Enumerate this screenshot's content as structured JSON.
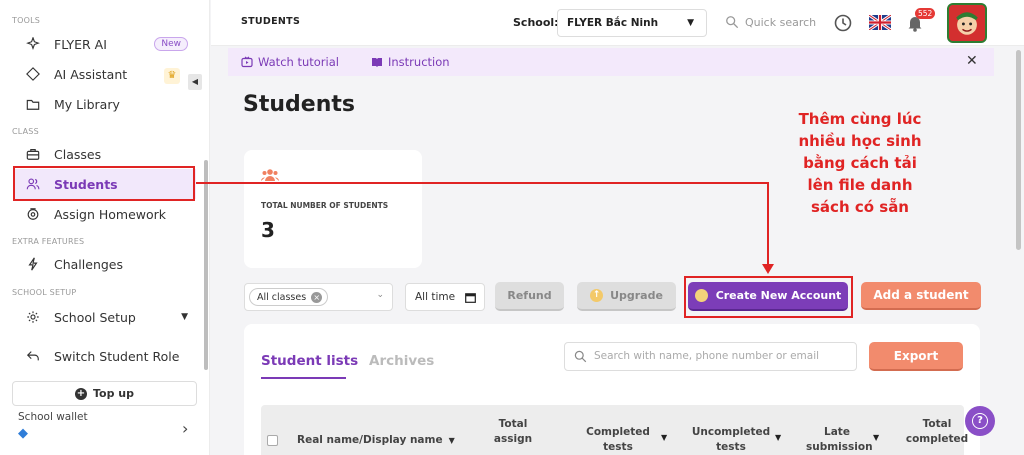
{
  "sidebar": {
    "sections": {
      "tools": "TOOLS",
      "class": "CLASS",
      "extra": "EXTRA FEATURES",
      "school_setup": "SCHOOL SETUP"
    },
    "items": [
      {
        "label": "FLYER AI",
        "icon": "sparkle-icon",
        "badge": "New"
      },
      {
        "label": "AI Assistant",
        "icon": "diamond-star-icon"
      },
      {
        "label": "My Library",
        "icon": "folder-icon"
      },
      {
        "label": "Classes",
        "icon": "briefcase-icon"
      },
      {
        "label": "Students",
        "icon": "users-icon",
        "active": true
      },
      {
        "label": "Assign Homework",
        "icon": "gear-badge-icon"
      },
      {
        "label": "Challenges",
        "icon": "lightning-icon"
      },
      {
        "label": "School Setup",
        "icon": "settings-icon"
      },
      {
        "label": "Switch Student Role",
        "icon": "switch-arrow-icon"
      }
    ],
    "top_up_label": "Top up",
    "wallet_label": "School wallet"
  },
  "header": {
    "crumb": "STUDENTS",
    "school_label": "School:",
    "school_value": "FLYER Bắc Ninh",
    "quick_search": "Quick search",
    "notif_count": "552"
  },
  "banner": {
    "watch_tutorial": "Watch tutorial",
    "instruction": "Instruction"
  },
  "page_title": "Students",
  "stats": {
    "label": "TOTAL NUMBER OF STUDENTS",
    "value": "3"
  },
  "annotation": {
    "lines": [
      "Thêm cùng lúc",
      "nhiều học sinh",
      "bằng cách tải",
      "lên file danh",
      "sách có sẵn"
    ]
  },
  "toolbar": {
    "class_chip": "All classes",
    "time_filter": "All time",
    "refund": "Refund",
    "upgrade": "Upgrade",
    "create": "Create New Account",
    "add": "Add a student"
  },
  "list": {
    "tab_active": "Student lists",
    "tab_archives": "Archives",
    "search_placeholder": "Search with name, phone number or email",
    "export": "Export",
    "columns": [
      "Real name/Display name",
      "Total assign",
      "Completed tests",
      "Uncompleted tests",
      "Late submission",
      "Total completed"
    ]
  },
  "colors": {
    "primary": "#7c3db8",
    "accent": "#f28b6d",
    "annotation": "#e02424"
  }
}
